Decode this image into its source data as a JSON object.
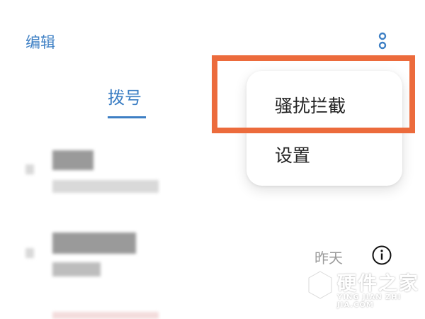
{
  "header": {
    "edit_label": "编辑"
  },
  "tabs": {
    "dial_label": "拨号"
  },
  "call_log": {
    "entries": [
      {
        "time": ""
      },
      {
        "time": "昨天"
      }
    ]
  },
  "overflow_menu": {
    "items": [
      {
        "label": "骚扰拦截"
      },
      {
        "label": "设置"
      }
    ]
  },
  "watermark": {
    "title": "硬件之家",
    "subtitle": "YING JIAN ZHI JIA.COM"
  },
  "colors": {
    "accent": "#3d7fc4",
    "highlight": "#ec6b3c",
    "secondary_text": "#9a9a9a",
    "primary_text": "#222222"
  },
  "icons": {
    "more": "more-vertical-icon",
    "info": "info-icon",
    "watermark_logo": "cube-logo-icon"
  }
}
